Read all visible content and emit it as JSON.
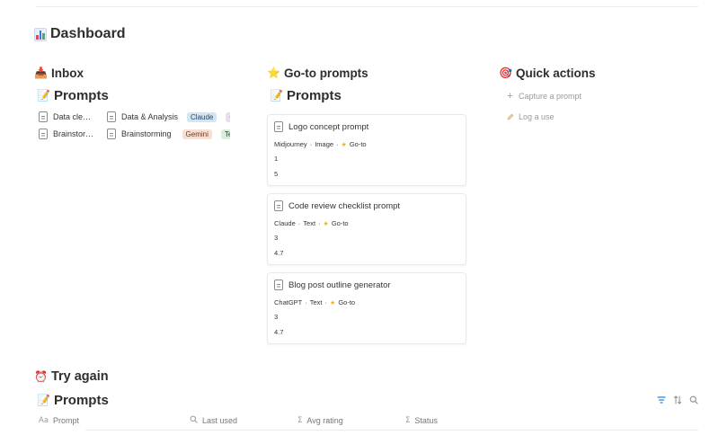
{
  "page": {
    "title": "Dashboard",
    "title_icon": "bar-chart-icon"
  },
  "inbox": {
    "title": "Inbox",
    "icon": "📥",
    "view_title": "Prompts",
    "view_icon": "📝",
    "rows": [
      {
        "name": "Data clea…",
        "category": "Data & Analysis",
        "model": "Claude",
        "extra": "C"
      },
      {
        "name": "Brainstor…",
        "category": "Brainstorming",
        "model": "Gemini",
        "extra": "Te"
      }
    ]
  },
  "goto": {
    "title": "Go-to prompts",
    "icon": "⭐",
    "view_title": "Prompts",
    "view_icon": "📝",
    "cards": [
      {
        "title": "Logo concept prompt",
        "model": "Midjourney",
        "type": "Image",
        "badge": "Go-to",
        "uses": "1",
        "rating": "5"
      },
      {
        "title": "Code review checklist prompt",
        "model": "Claude",
        "type": "Text",
        "badge": "Go-to",
        "uses": "3",
        "rating": "4.7"
      },
      {
        "title": "Blog post outline generator",
        "model": "ChatGPT",
        "type": "Text",
        "badge": "Go-to",
        "uses": "3",
        "rating": "4.7"
      }
    ]
  },
  "quick_actions": {
    "title": "Quick actions",
    "icon": "🎯",
    "items": [
      {
        "label": "Capture a prompt",
        "icon": "plus-icon"
      },
      {
        "label": "Log a use",
        "icon": "pencil-icon"
      }
    ]
  },
  "try_again": {
    "title": "Try again",
    "icon": "⏰",
    "view_title": "Prompts",
    "view_icon": "📝",
    "columns": [
      {
        "label": "Prompt",
        "icon": "Aa"
      },
      {
        "label": "Last used",
        "icon": "🔍"
      },
      {
        "label": "Avg rating",
        "icon": "Σ"
      },
      {
        "label": "Status",
        "icon": "Σ"
      }
    ]
  },
  "colors": {
    "filter_icon": "#2383e2",
    "muted_text": "#9b9a97"
  }
}
